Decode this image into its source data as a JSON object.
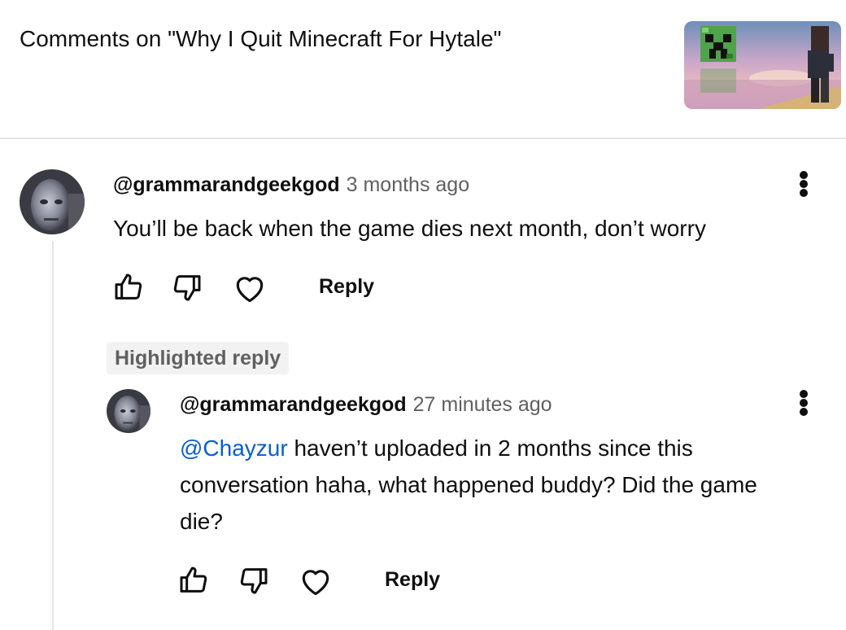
{
  "header": {
    "title": "Comments on \"Why I Quit Minecraft For Hytale\""
  },
  "comment": {
    "author": "@grammarandgeekgod",
    "time": "3 months ago",
    "text": "You’ll be back when the game dies next month, don’t worry",
    "reply_label": "Reply"
  },
  "highlighted_label": "Highlighted reply",
  "reply": {
    "author": "@grammarandgeekgod",
    "time": "27 minutes ago",
    "mention": "@Chayzur",
    "text_line1": " haven’t uploaded in 2 months since this",
    "text_line2": "conversation haha, what happened buddy? Did the game",
    "text_line3": "die?",
    "reply_label": "Reply"
  },
  "icons": [
    "thumbs-up-icon",
    "thumbs-down-icon",
    "heart-icon",
    "more-vert-icon"
  ]
}
